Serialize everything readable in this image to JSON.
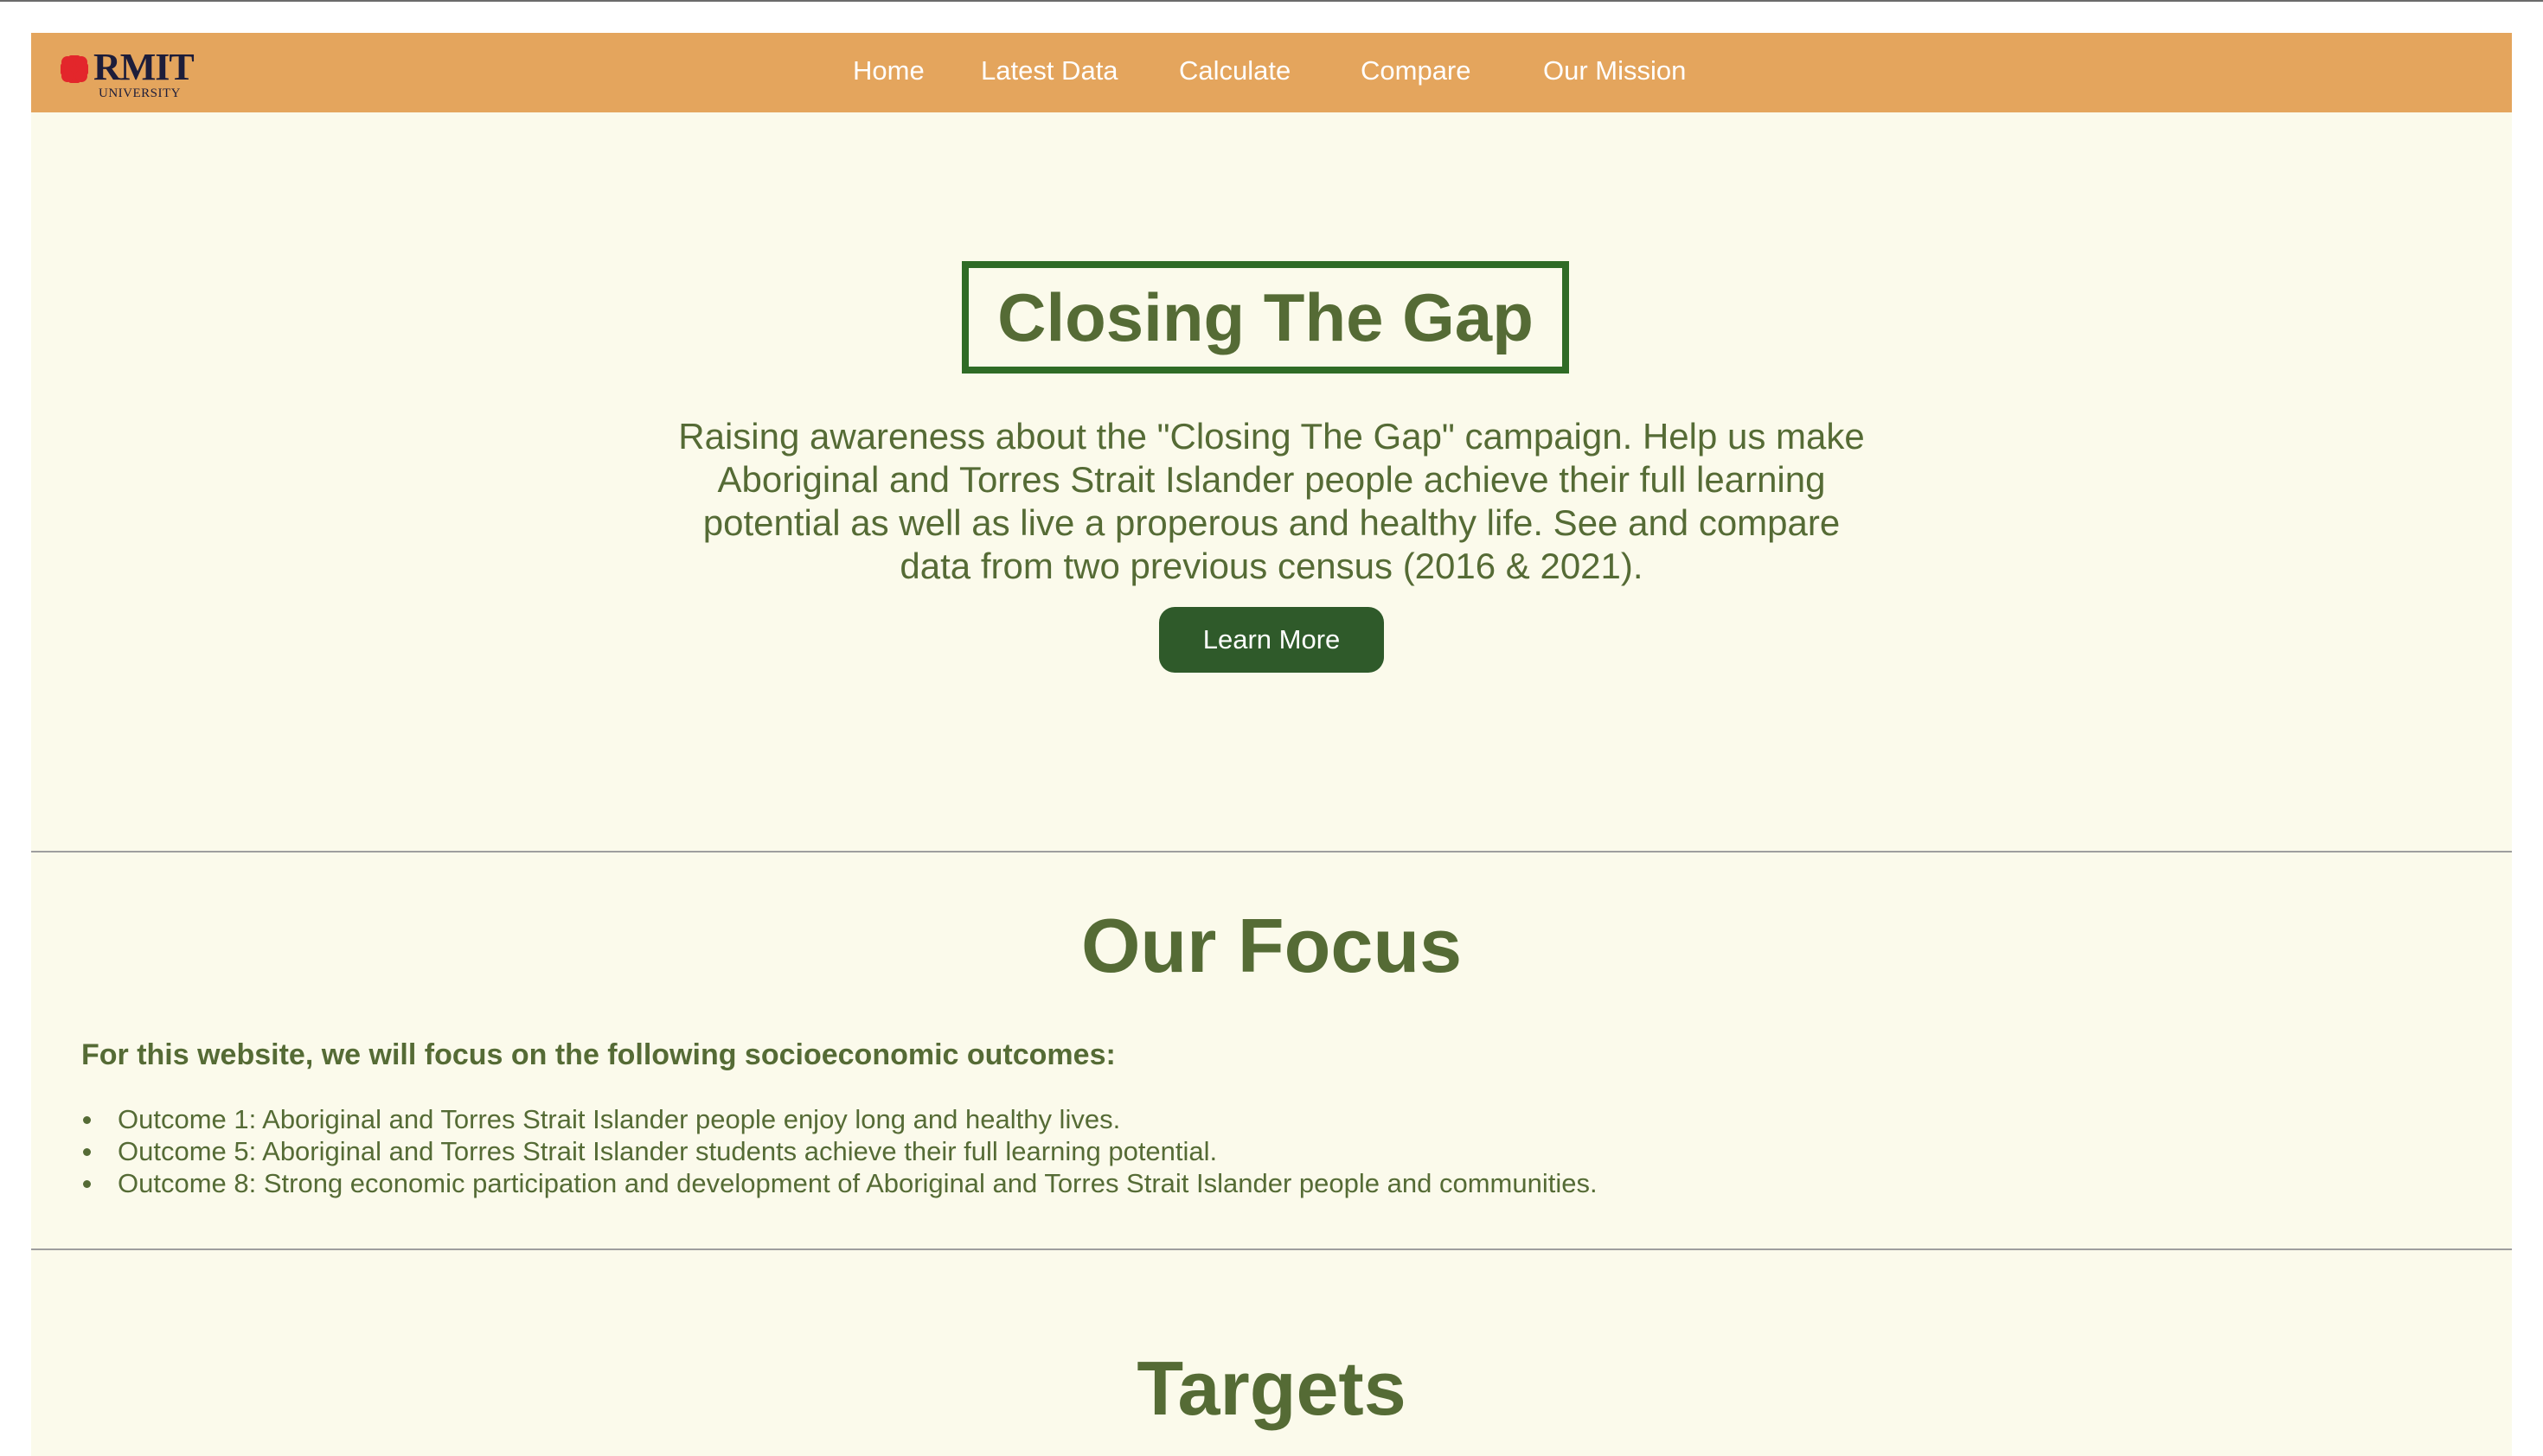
{
  "nav": {
    "logo_text": "RMIT",
    "logo_subtext": "UNIVERSITY",
    "links": [
      "Home",
      "Latest Data",
      "Calculate",
      "Compare",
      "Our Mission"
    ]
  },
  "hero": {
    "title": "Closing The Gap",
    "description": "Raising awareness about the \"Closing The Gap\" campaign. Help us make Aboriginal and Torres Strait Islander people achieve their full learning potential as well as live a properous and healthy life. See and compare data from two previous census (2016 & 2021).",
    "button_label": "Learn More"
  },
  "focus": {
    "heading": "Our Focus",
    "intro": "For this website, we will focus on the following socioeconomic outcomes:",
    "outcomes": [
      "Outcome 1: Aboriginal and Torres Strait Islander people enjoy long and healthy lives.",
      "Outcome 5: Aboriginal and Torres Strait Islander students achieve their full learning potential.",
      "Outcome 8: Strong economic participation and development of Aboriginal and Torres Strait Islander people and communities."
    ]
  },
  "targets": {
    "heading": "Targets"
  },
  "colors": {
    "navbar": "#e4a55d",
    "page_background": "#fbfaeb",
    "text_green": "#556b35",
    "title_border": "#2f6b26",
    "button": "#2f5a2a",
    "logo_red": "#e3262b"
  }
}
